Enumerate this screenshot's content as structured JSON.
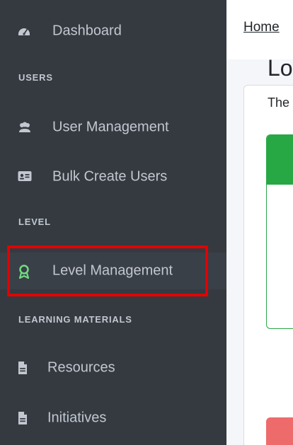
{
  "sidebar": {
    "items": [
      {
        "label": "Dashboard",
        "icon": "dashboard-icon"
      },
      {
        "label": "User Management",
        "icon": "users-icon"
      },
      {
        "label": "Bulk Create Users",
        "icon": "id-card-icon"
      },
      {
        "label": "Level Management",
        "icon": "award-icon",
        "active": true
      },
      {
        "label": "Resources",
        "icon": "file-icon"
      },
      {
        "label": "Initiatives",
        "icon": "file-icon"
      }
    ],
    "sections": [
      {
        "label": "USERS"
      },
      {
        "label": "LEVEL"
      },
      {
        "label": "LEARNING MATERIALS"
      }
    ]
  },
  "topbar": {
    "breadcrumb_label": "Home"
  },
  "main": {
    "title": "Lo",
    "subtitle": "The"
  },
  "colors": {
    "sidebar_bg": "#343a40",
    "sidebar_text": "#c2c7d0",
    "highlight": "#e30000",
    "green_accent": "#28a745",
    "red_accent": "#ee6b6b"
  }
}
